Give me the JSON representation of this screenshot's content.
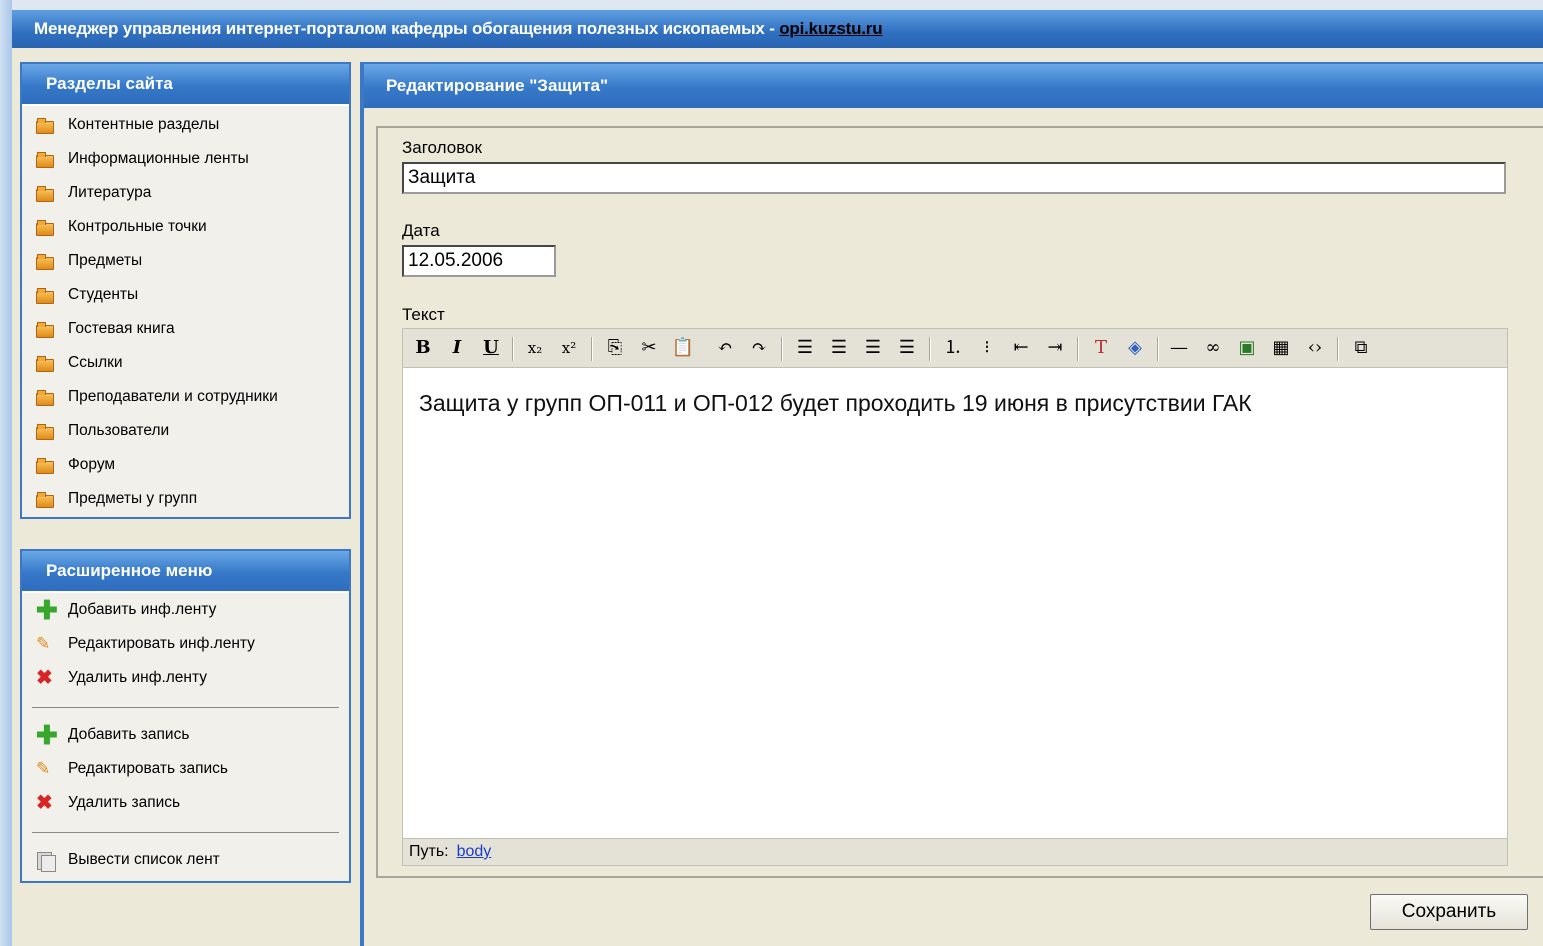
{
  "header": {
    "title": "Менеджер управления интернет-порталом кафедры обогащения полезных ископаемых - ",
    "site_link": "opi.kuzstu.ru"
  },
  "sections_panel": {
    "title": "Разделы сайта",
    "icon": "folder-icon",
    "items": [
      {
        "label": "Контентные разделы"
      },
      {
        "label": "Информационные ленты"
      },
      {
        "label": "Литература"
      },
      {
        "label": "Контрольные точки"
      },
      {
        "label": "Предметы"
      },
      {
        "label": "Студенты"
      },
      {
        "label": "Гостевая книга"
      },
      {
        "label": "Ссылки"
      },
      {
        "label": "Преподаватели и сотрудники"
      },
      {
        "label": "Пользователи"
      },
      {
        "label": "Форум"
      },
      {
        "label": "Предметы у групп"
      }
    ]
  },
  "extended_menu": {
    "title": "Расширенное меню",
    "feed_actions": [
      {
        "label": "Добавить инф.ленту",
        "icon": "plus-icon"
      },
      {
        "label": "Редактировать инф.ленту",
        "icon": "pencil-icon"
      },
      {
        "label": "Удалить инф.ленту",
        "icon": "x-icon"
      }
    ],
    "record_actions": [
      {
        "label": "Добавить запись",
        "icon": "plus-icon"
      },
      {
        "label": "Редактировать запись",
        "icon": "pencil-icon"
      },
      {
        "label": "Удалить запись",
        "icon": "x-icon"
      }
    ],
    "list_action": {
      "label": "Вывести список лент",
      "icon": "list-icon"
    }
  },
  "editor_panel": {
    "title": "Редактирование \"Защита\"",
    "title_label": "Заголовок",
    "title_value": "Защита",
    "date_label": "Дата",
    "date_value": "12.05.2006",
    "text_label": "Текст",
    "text_content": "Защита у групп ОП-011 и ОП-012 будет проходить 19 июня в присутствии ГАК",
    "path_label": "Путь:",
    "path_value": "body",
    "save_label": "Сохранить"
  },
  "colors": {
    "header_blue": "#2f6fc0",
    "panel_border": "#3d78c6",
    "background": "#ece9d8"
  }
}
